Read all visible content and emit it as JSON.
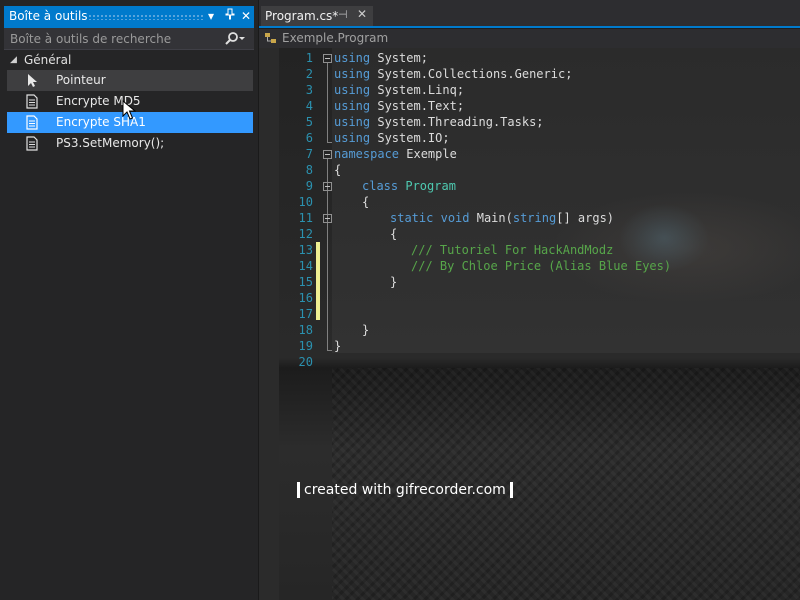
{
  "toolbox": {
    "title": "Boîte à outils",
    "search_placeholder": "Boîte à outils de recherche",
    "group": "Général",
    "items": [
      {
        "label": "Pointeur",
        "icon": "pointer-icon"
      },
      {
        "label": "Encrypte MD5",
        "icon": "document-icon"
      },
      {
        "label": "Encrypte SHA1",
        "icon": "document-icon"
      },
      {
        "label": "PS3.SetMemory();",
        "icon": "document-icon"
      }
    ],
    "selected_index": 2,
    "hover_index": 0
  },
  "editor": {
    "tab_label": "Program.cs*",
    "nav_label": "Exemple.Program",
    "line_numbers": [
      "1",
      "2",
      "3",
      "4",
      "5",
      "6",
      "7",
      "8",
      "9",
      "10",
      "11",
      "12",
      "13",
      "14",
      "15",
      "16",
      "17",
      "18",
      "19",
      "20"
    ]
  },
  "code": {
    "l1_kw": "using",
    "l1_rest": " System;",
    "l2_kw": "using",
    "l2_rest": " System.Collections.Generic;",
    "l3_kw": "using",
    "l3_rest": " System.Linq;",
    "l4_kw": "using",
    "l4_rest": " System.Text;",
    "l5_kw": "using",
    "l5_rest": " System.Threading.Tasks;",
    "l6_kw": "using",
    "l6_rest": " System.IO;",
    "l7_kw": "namespace",
    "l7_rest": " Exemple",
    "l8": "{",
    "l9_kw": "class",
    "l9_ty": "Program",
    "l10": "{",
    "l11_kw1": "static",
    "l11_kw2": "void",
    "l11_name": "Main(",
    "l11_kw3": "string",
    "l11_rest": "[] args)",
    "l12": "{",
    "l13": "/// Tutoriel For HackAndModz",
    "l14": "/// By Chloe Price (Alias Blue Eyes)",
    "l15": "}",
    "l18": "}",
    "l19": "}"
  },
  "watermark": "created with gifrecorder.com",
  "colors": {
    "accent": "#007acc",
    "selection": "#3399ff",
    "keyword": "#569cd6",
    "type": "#4ec9b0",
    "comment": "#57a64a",
    "line_number": "#2b91af",
    "change_marker": "#efef92"
  }
}
